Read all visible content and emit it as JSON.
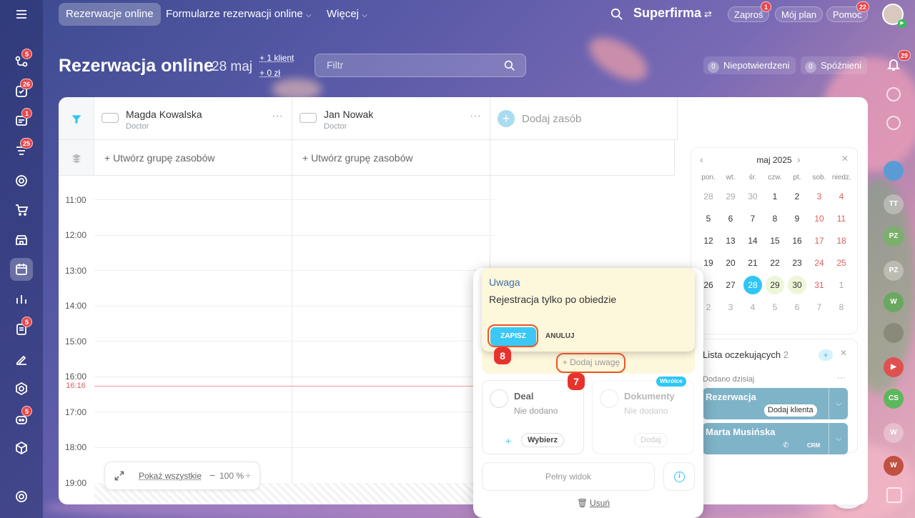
{
  "topbar": {
    "tabs": [
      "Rezerwacje online",
      "Formularze rezerwacji online",
      "Więcej"
    ],
    "company": "Superfirma",
    "invite": "Zaproś",
    "invite_badge": "1",
    "plan": "Mój plan",
    "help": "Pomoc",
    "help_badge": "22"
  },
  "sidebar": {
    "badges": [
      "5",
      "26",
      "1",
      "25",
      "5",
      "5"
    ]
  },
  "header": {
    "title": "Rezerwacja online",
    "date": "28 maj",
    "clients": "+ 1 klient",
    "amount": "+ 0 zł",
    "filter_placeholder": "Filtr",
    "unconfirmed_count": "0",
    "unconfirmed_label": "Niepotwierdzeni",
    "late_count": "0",
    "late_label": "Spóźnieni",
    "notifications": "29"
  },
  "resources": [
    {
      "name": "Magda Kowalska",
      "role": "Doctor"
    },
    {
      "name": "Jan Nowak",
      "role": "Doctor"
    }
  ],
  "add_resource": "Dodaj zasób",
  "create_group": "+ Utwórz grupę zasobów",
  "hours": [
    "11:00",
    "12:00",
    "13:00",
    "14:00",
    "15:00",
    "16:00",
    "17:00",
    "18:00",
    "19:00"
  ],
  "current_time": "16:16",
  "zoom": {
    "show_all": "Pokaż wszystkie",
    "minus": "−",
    "level": "100 %",
    "plus": "+"
  },
  "calendar": {
    "month": "maj 2025",
    "dows": [
      "pon.",
      "wt.",
      "śr.",
      "czw.",
      "pt.",
      "sob.",
      "niedz."
    ],
    "weeks": [
      [
        "28",
        "29",
        "30",
        "1",
        "2",
        "3",
        "4"
      ],
      [
        "5",
        "6",
        "7",
        "8",
        "9",
        "10",
        "11"
      ],
      [
        "12",
        "13",
        "14",
        "15",
        "16",
        "17",
        "18"
      ],
      [
        "19",
        "20",
        "21",
        "22",
        "23",
        "24",
        "25"
      ],
      [
        "26",
        "27",
        "28",
        "29",
        "30",
        "31",
        "1"
      ],
      [
        "2",
        "3",
        "4",
        "5",
        "6",
        "7",
        "8"
      ]
    ]
  },
  "waiting": {
    "title": "Lista oczekujących",
    "count": "2",
    "today": "Dodano dzisiaj",
    "cards": [
      {
        "name": "Rezerwacja",
        "action": "Dodaj klienta"
      },
      {
        "name": "Marta Musińska",
        "tag": "CRM"
      }
    ]
  },
  "note": {
    "title": "Uwaga",
    "text": "Rejestracja tylko po obiedzie",
    "save": "ZAPISZ",
    "cancel": "ANULUJ"
  },
  "popup": {
    "add_note": "+ Dodaj uwagę",
    "deal_title": "Deal",
    "deal_status": "Nie dodano",
    "deal_choose": "Wybierz",
    "docs_badge": "Wkrótce",
    "docs_title": "Dokumenty",
    "docs_status": "Nie dodano",
    "docs_add": "Dodaj",
    "full_view": "Pełny widok",
    "delete": "Usuń"
  },
  "markers": [
    "8",
    "7"
  ],
  "right_avatars": [
    "TT",
    "PZ",
    "PZ",
    "W",
    "CS",
    "W",
    "W"
  ]
}
